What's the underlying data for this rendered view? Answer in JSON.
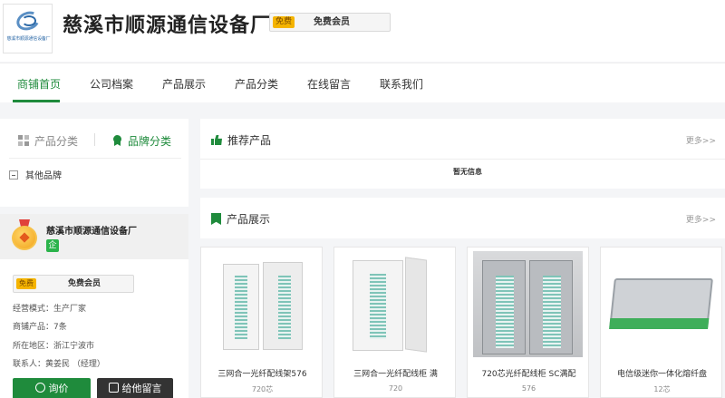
{
  "header": {
    "logo_icon": "company-logo",
    "logo_text": "慈溪市顺源通信设备厂",
    "company_name": "慈溪市顺源通信设备厂",
    "member_tag": "免费",
    "member_label": "免费会员"
  },
  "nav": {
    "items": [
      {
        "label": "商铺首页",
        "active": true
      },
      {
        "label": "公司档案"
      },
      {
        "label": "产品展示"
      },
      {
        "label": "产品分类"
      },
      {
        "label": "在线留言"
      },
      {
        "label": "联系我们"
      }
    ]
  },
  "sidebar": {
    "tab_product": "产品分类",
    "tab_brand": "品牌分类",
    "brand_item": "其他品牌",
    "card": {
      "company": "慈溪市顺源通信设备厂",
      "qi": "企",
      "member_tag": "免费",
      "member_label": "免费会员",
      "business_mode": "经营模式：生产厂家",
      "products": "商铺产品：7条",
      "location": "所在地区：浙江宁波市",
      "contact": "联系人：黄姜民 （经理）",
      "btn_inquiry": "询价",
      "btn_message": "给他留言"
    }
  },
  "recommended": {
    "title": "推荐产品",
    "more": "更多>>",
    "empty": "暂无信息"
  },
  "products": {
    "title": "产品展示",
    "more": "更多>>",
    "items": [
      {
        "name": "三网合一光纤配线架576",
        "spec": "720芯"
      },
      {
        "name": "三网合一光纤配线柜 满",
        "spec": "720"
      },
      {
        "name": "720芯光纤配线柜 SC满配",
        "spec": "576"
      },
      {
        "name": "电信级迷你一体化熔纤盘",
        "spec": "12芯"
      }
    ]
  },
  "colors": {
    "accent": "#1f8b3c",
    "gold": "#f5b400"
  }
}
